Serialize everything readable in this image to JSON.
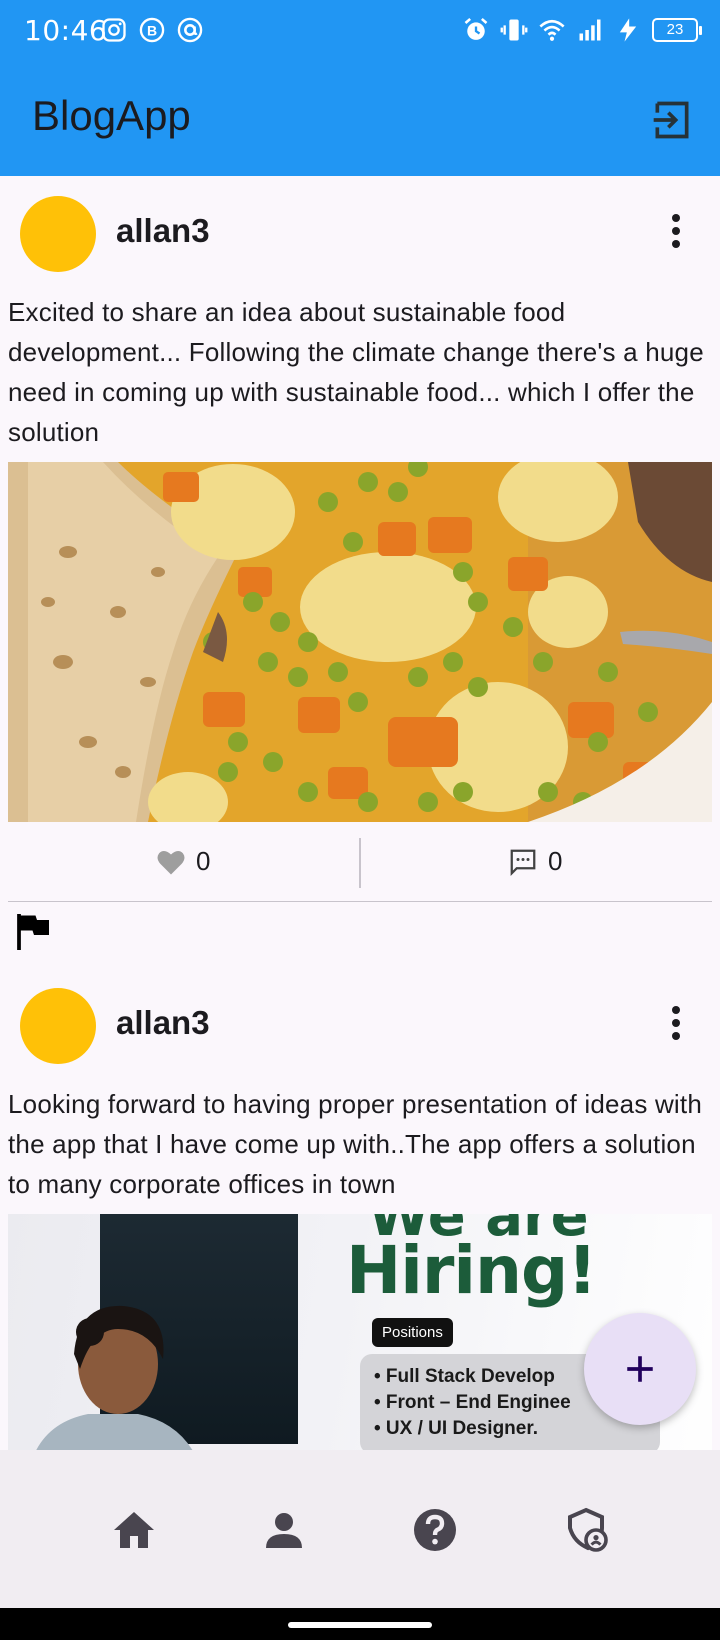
{
  "status_bar": {
    "time": "10:46",
    "battery": "23",
    "left_icons": [
      "instagram-icon",
      "b-app-icon",
      "at-sign-icon"
    ],
    "right_icons": [
      "alarm-icon",
      "vibrate-icon",
      "wifi-icon",
      "signal-icon",
      "charging-icon"
    ]
  },
  "app_bar": {
    "title": "BlogApp",
    "action_icon": "logout-icon",
    "color": "#2196f3"
  },
  "posts": [
    {
      "username": "allan3",
      "avatar_color": "#ffc107",
      "text": "Excited to share an idea about sustainable food development... Following the climate change there's a huge need in coming up with sustainable food... which I offer the solution",
      "image": "food-photo",
      "likes": "0",
      "comments": "0"
    },
    {
      "username": "allan3",
      "avatar_color": "#ffc107",
      "text": "Looking forward to having proper presentation of ideas with the app that I have come up with..The app offers a solution to many corporate offices in town",
      "image": {
        "hiring_top": "We are",
        "hiring": "Hiring!",
        "tag": "Positions",
        "positions": [
          "• Full Stack Develop",
          "• Front – End Enginee",
          "• UX / UI Designer."
        ]
      }
    }
  ],
  "fab": {
    "icon": "plus-icon"
  },
  "bottom_nav": {
    "items": [
      "home-icon",
      "person-icon",
      "help-icon",
      "admin-shield-icon"
    ]
  }
}
